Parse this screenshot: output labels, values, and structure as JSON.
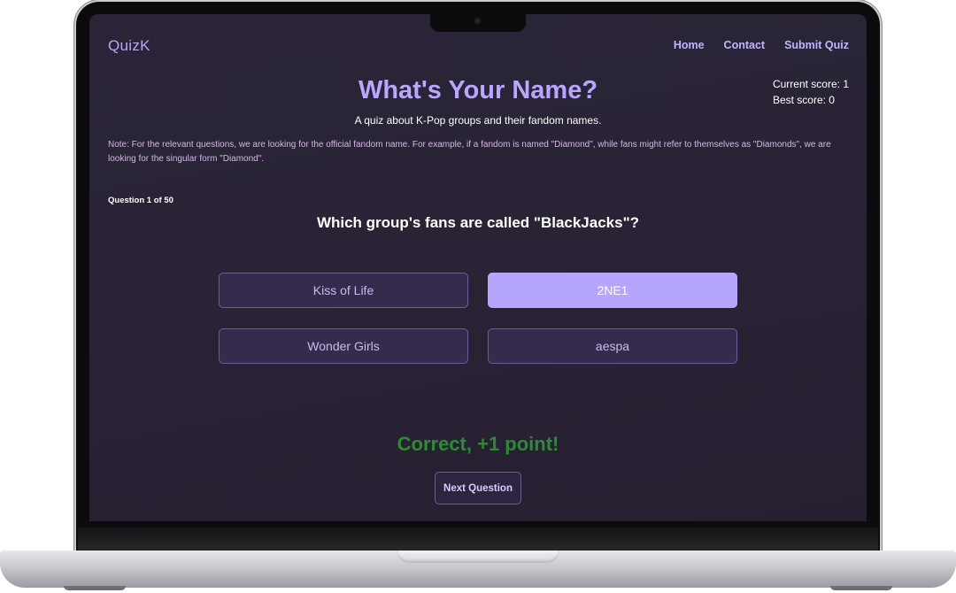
{
  "app": {
    "logo": "QuizK"
  },
  "nav": {
    "items": [
      "Home",
      "Contact",
      "Submit Quiz"
    ]
  },
  "score": {
    "current_label": "Current score: 1",
    "best_label": "Best score: 0"
  },
  "header": {
    "title": "What's Your Name?",
    "subtitle": "A quiz about K-Pop groups and their fandom names."
  },
  "note": "Note: For the relevant questions, we are looking for the official fandom name. For example, if a fandom is named \"Diamond\", while fans might refer to themselves as \"Diamonds\", we are looking for the singular form \"Diamond\".",
  "quiz": {
    "counter": "Question 1 of 50",
    "question": "Which group's fans are called \"BlackJacks\"?",
    "answers": [
      "Kiss of Life",
      "2NE1",
      "Wonder Girls",
      "aespa"
    ],
    "selected_answer": "2NE1",
    "feedback": "Correct, +1 point!",
    "next_label": "Next Question"
  },
  "colors": {
    "accent": "#b9a6ff",
    "selected": "#b5a6fb",
    "correct": "#2e8a37",
    "background": "#2a2336"
  }
}
